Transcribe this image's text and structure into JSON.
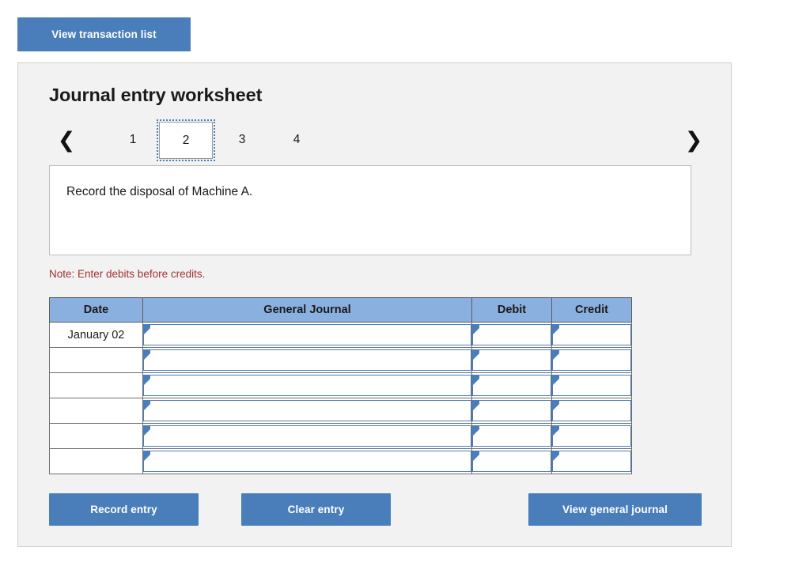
{
  "toolbar": {
    "view_transaction_list_label": "View transaction list"
  },
  "panel": {
    "title": "Journal entry worksheet",
    "pager": {
      "prev_icon": "chevron-left-icon",
      "next_icon": "chevron-right-icon",
      "tabs": [
        {
          "label": "1",
          "selected": false
        },
        {
          "label": "2",
          "selected": true
        },
        {
          "label": "3",
          "selected": false
        },
        {
          "label": "4",
          "selected": false
        }
      ]
    },
    "prompt": "Record the disposal of Machine A.",
    "note": "Note: Enter debits before credits.",
    "table": {
      "columns": [
        "Date",
        "General Journal",
        "Debit",
        "Credit"
      ],
      "rows": [
        {
          "date": "January 02",
          "general_journal": "",
          "debit": "",
          "credit": ""
        },
        {
          "date": "",
          "general_journal": "",
          "debit": "",
          "credit": ""
        },
        {
          "date": "",
          "general_journal": "",
          "debit": "",
          "credit": ""
        },
        {
          "date": "",
          "general_journal": "",
          "debit": "",
          "credit": ""
        },
        {
          "date": "",
          "general_journal": "",
          "debit": "",
          "credit": ""
        },
        {
          "date": "",
          "general_journal": "",
          "debit": "",
          "credit": ""
        }
      ]
    },
    "actions": {
      "record_entry_label": "Record entry",
      "clear_entry_label": "Clear entry",
      "view_general_journal_label": "View general journal"
    }
  },
  "colors": {
    "button_blue": "#4a7ebb",
    "header_blue": "#8ab0e0",
    "panel_bg": "#f2f2f2",
    "note_red": "#a33131"
  }
}
